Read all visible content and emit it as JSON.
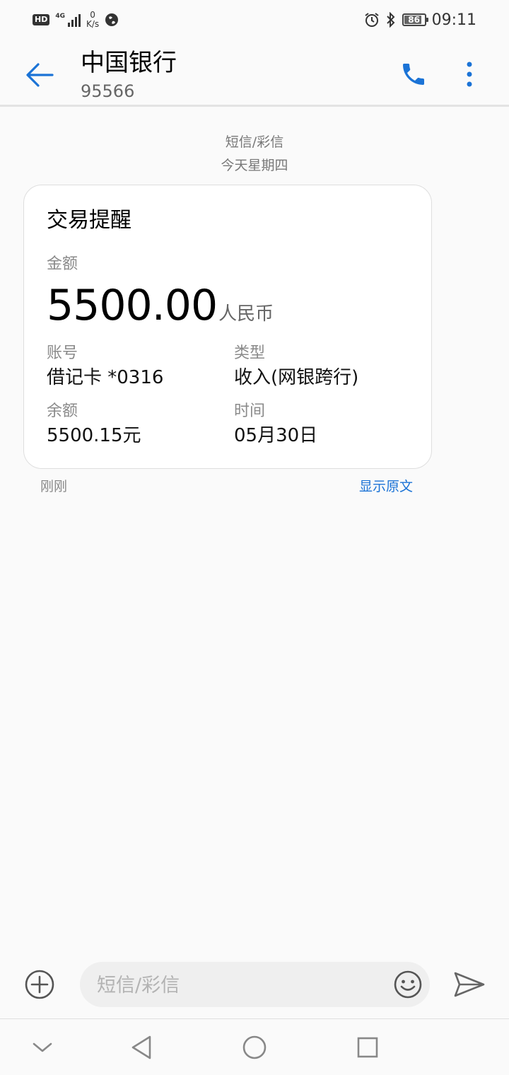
{
  "status_bar": {
    "hd": "HD",
    "network": "4G",
    "speed_value": "0",
    "speed_unit": "K/s",
    "battery": "86",
    "time": "09:11"
  },
  "header": {
    "title": "中国银行",
    "number": "95566"
  },
  "meta": {
    "type": "短信/彩信",
    "date": "今天星期四"
  },
  "card": {
    "title": "交易提醒",
    "amount_label": "金额",
    "amount": "5500.00",
    "currency": "人民币",
    "account_label": "账号",
    "account_value": "借记卡 *0316",
    "type_label": "类型",
    "type_value": "收入(网银跨行)",
    "balance_label": "余额",
    "balance_value": "5500.15元",
    "time_label": "时间",
    "time_value": "05月30日"
  },
  "footer": {
    "timestamp": "刚刚",
    "show_original": "显示原文"
  },
  "composer": {
    "placeholder": "短信/彩信"
  },
  "colors": {
    "accent": "#1b73d6",
    "background": "#fafafa"
  },
  "icons": [
    "back-arrow-icon",
    "phone-icon",
    "more-vert-icon",
    "add-circle-icon",
    "emoji-icon",
    "send-icon",
    "nav-down-icon",
    "nav-back-icon",
    "nav-home-icon",
    "nav-recents-icon"
  ]
}
